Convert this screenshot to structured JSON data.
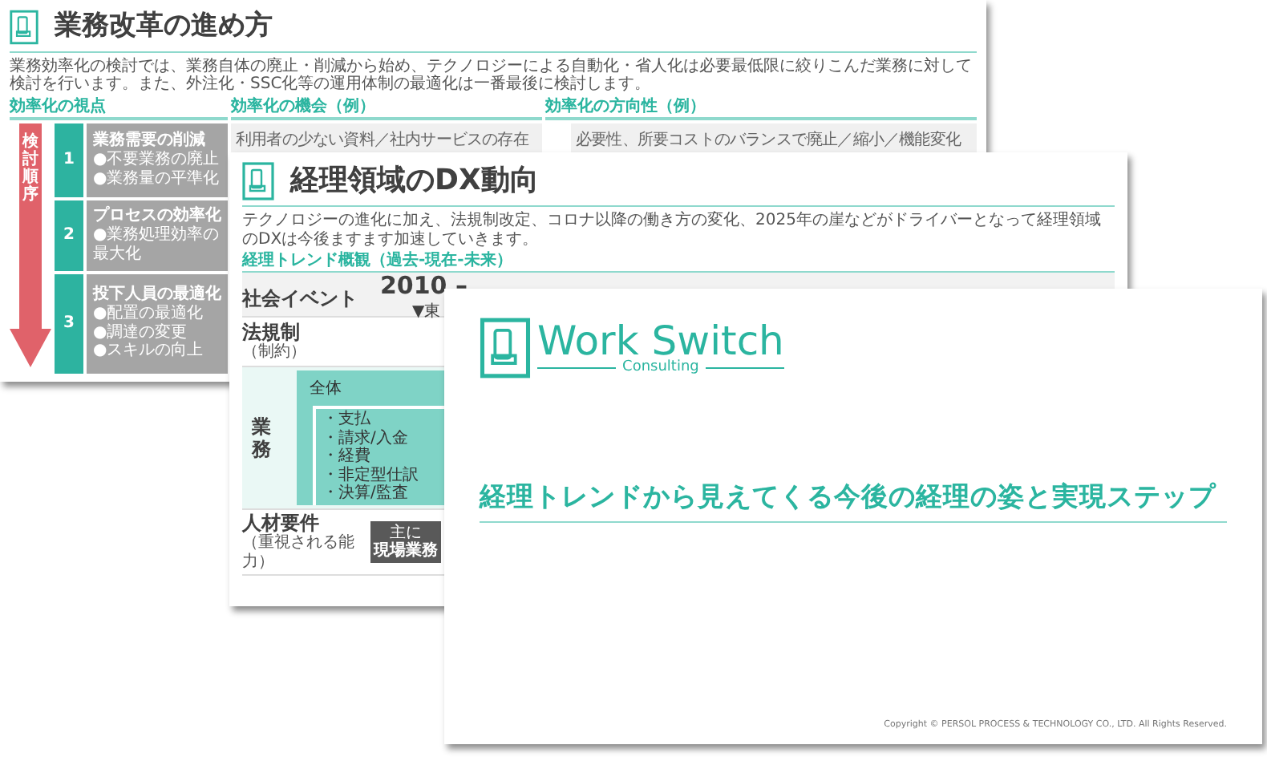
{
  "back_slide": {
    "title": "業務改革の進め方",
    "description": "業務効率化の検討では、業務自体の廃止・削減から始め、テクノロジーによる自動化・省人化は必要最低限に絞りこんだ業務に対して検討を行います。また、外注化・SSC化等の運用体制の最適化は一番最後に検討します。",
    "section_headers": [
      "効率化の視点",
      "効率化の機会（例）",
      "効率化の方向性（例）"
    ],
    "order_label": "検討順序",
    "rows": [
      {
        "number": "1",
        "title": "業務需要の削減",
        "bullets": [
          "●不要業務の廃止",
          "●業務量の平準化"
        ],
        "example": "利用者の少ない資料／社内サービスの存在",
        "direction": "必要性、所要コストのバランスで廃止／縮小／機能変化"
      },
      {
        "number": "2",
        "title": "プロセスの効率化",
        "bullets": [
          "●業務処理効率の最大化"
        ]
      },
      {
        "number": "3",
        "title": "投下人員の最適化",
        "bullets": [
          "●配置の最適化",
          "●調達の変更",
          "●スキルの向上"
        ]
      }
    ]
  },
  "middle_slide": {
    "title": "経理領域のDX動向",
    "description": "テクノロジーの進化に加え、法規制改定、コロナ以降の働き方の変化、2025年の崖などがドライバーとなって経理領域のDXは今後ますます加速していきます。",
    "caption": "経理トレンド概観（過去-現在-未来）",
    "event_row": {
      "label": "社会イベント",
      "year": "2010 –",
      "marker": "▼東"
    },
    "law_row": {
      "label": "法規制",
      "sub": "（制約）"
    },
    "business_row": {
      "label": "業務",
      "overall": "全体",
      "items": [
        "・支払",
        "・請求/入金",
        "・経費",
        "・非定型仕訳",
        "・決算/監査"
      ]
    },
    "talent_row": {
      "label": "人材要件",
      "sub": "（重視される能力）",
      "badge": [
        "主に",
        "現場業務"
      ]
    }
  },
  "front_slide": {
    "logo": {
      "name": "Work Switch",
      "sub": "Consulting"
    },
    "title": "経理トレンドから見えてくる今後の経理の姿と実現ステップ",
    "copyright": "Copyright © PERSOL PROCESS & TECHNOLOGY CO., LTD. All Rights Reserved."
  }
}
